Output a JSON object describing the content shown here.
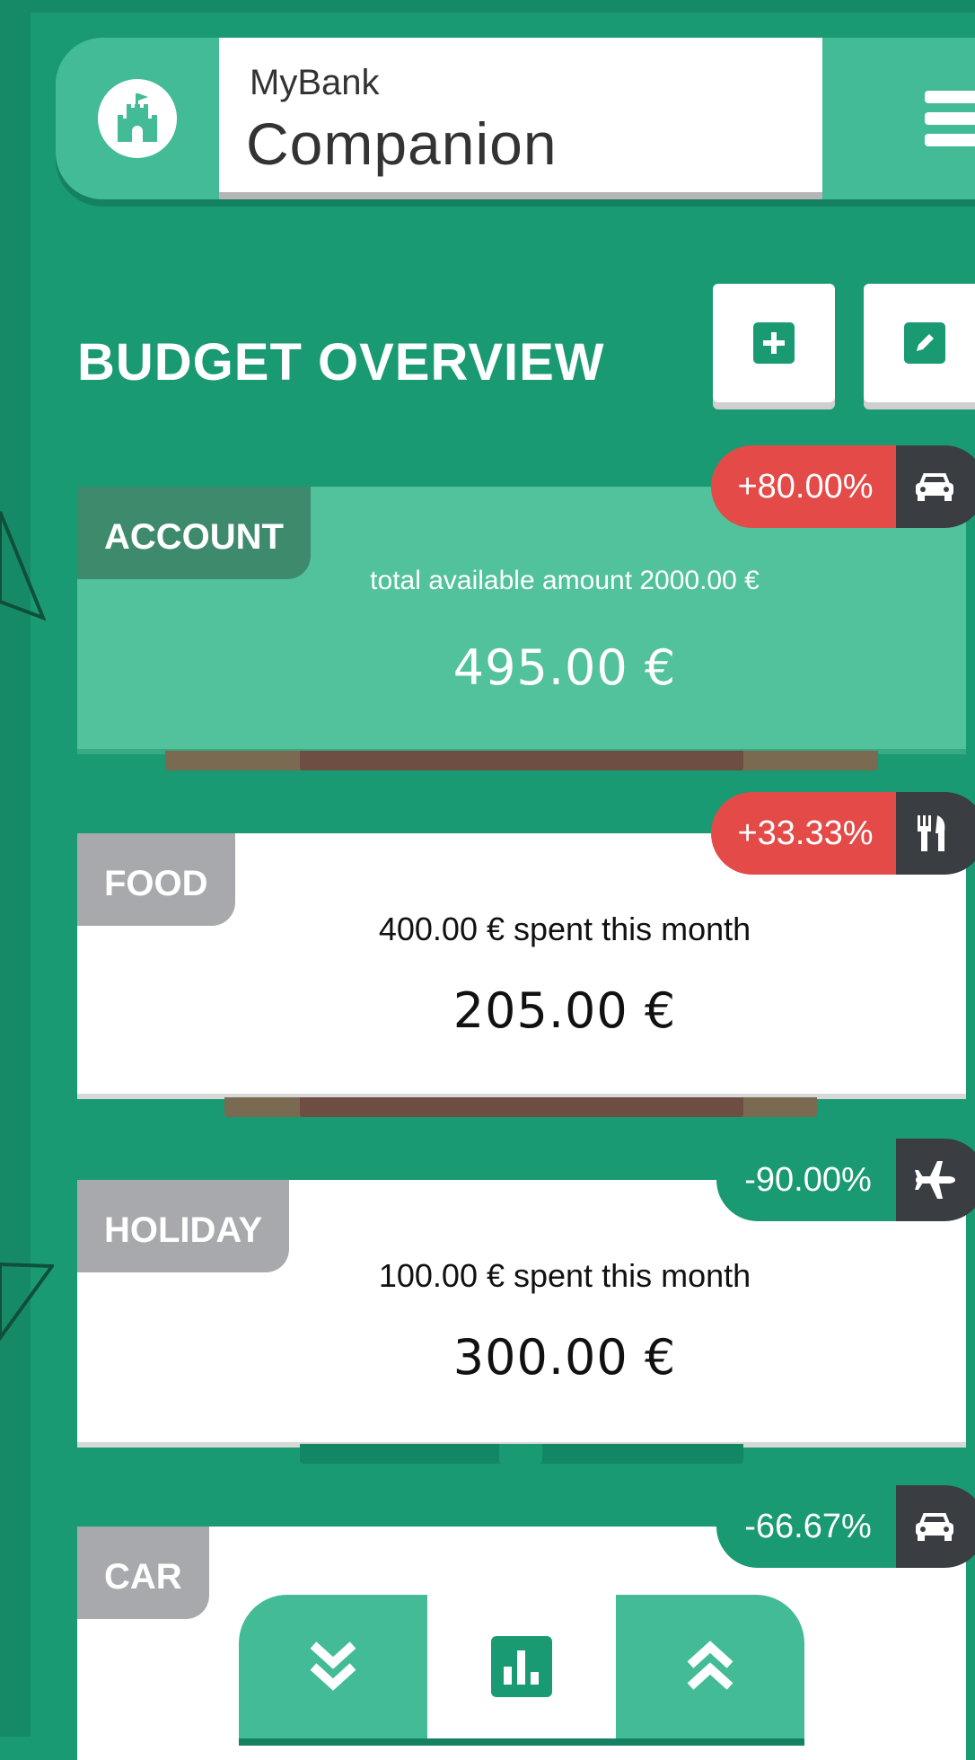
{
  "header": {
    "app_subtitle": "MyBank",
    "app_title": "Companion"
  },
  "section": {
    "title": "BUDGET OVERVIEW"
  },
  "cards": [
    {
      "tag": "ACCOUNT",
      "subtitle": "total available amount 2000.00 €",
      "amount": "495.00 €",
      "change": "+80.00%",
      "change_status": "red",
      "icon": "car-icon",
      "progress": 0.505
    },
    {
      "tag": "FOOD",
      "subtitle": "400.00 € spent this month",
      "amount": "205.00 €",
      "change": "+33.33%",
      "change_status": "red",
      "icon": "cutlery-icon",
      "progress": 0.666
    },
    {
      "tag": "HOLIDAY",
      "subtitle": "100.00 € spent this month",
      "amount": "300.00 €",
      "change": "-90.00%",
      "change_status": "green",
      "icon": "airplane-icon",
      "progress": 0.1
    },
    {
      "tag": "CAR",
      "subtitle": "",
      "amount": "",
      "change": "-66.67%",
      "change_status": "green",
      "icon": "car-icon"
    }
  ],
  "toolbar": {
    "add_icon": "plus-square-icon",
    "edit_icon": "pencil-square-icon"
  },
  "bottom_nav": {
    "down_icon": "double-chevron-down-icon",
    "chart_icon": "bar-chart-icon",
    "up_icon": "double-chevron-up-icon"
  },
  "colors": {
    "background": "#1a9a72",
    "accent_light": "#43bb97",
    "negative": "#e34a48",
    "icon_dark": "#3a3d42",
    "tag_grey": "#a8a9ad"
  }
}
